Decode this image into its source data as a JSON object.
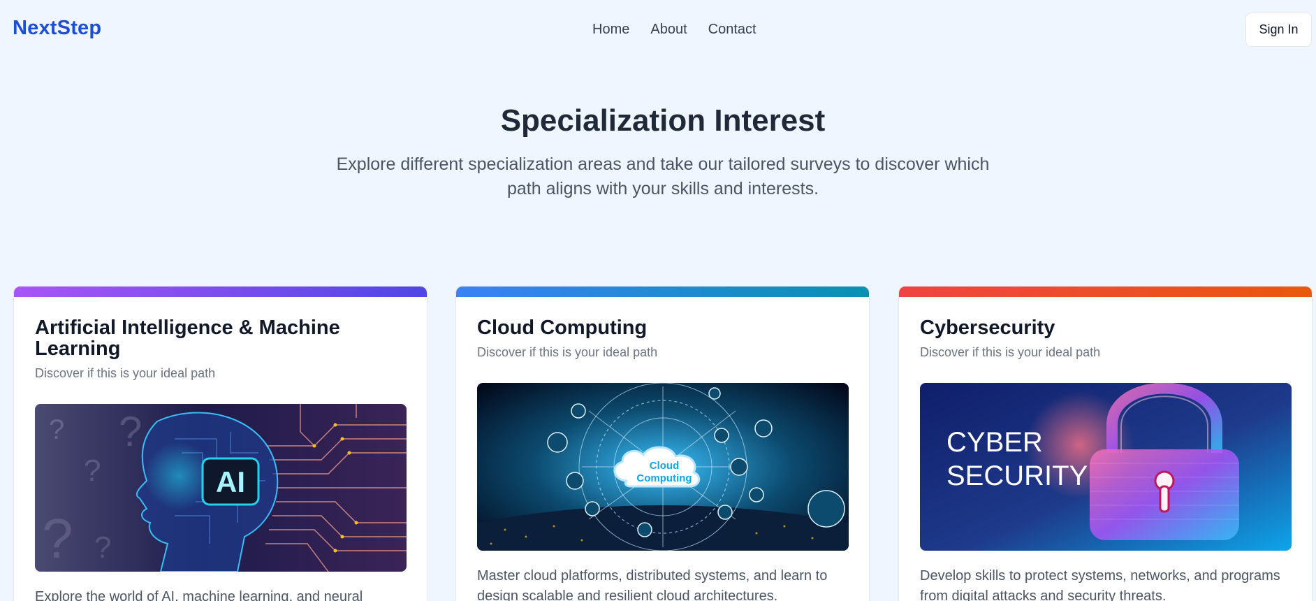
{
  "header": {
    "brand": "NextStep",
    "nav": [
      "Home",
      "About",
      "Contact"
    ],
    "sign_in": "Sign In"
  },
  "hero": {
    "title": "Specialization Interest",
    "subtitle": "Explore different specialization areas and take our tailored surveys to discover which path aligns with your skills and interests."
  },
  "cards": [
    {
      "title": "Artificial Intelligence & Machine Learning",
      "tagline": "Discover if this is your ideal path",
      "image_text": "AI",
      "description": "Explore the world of AI, machine learning, and neural",
      "accent_from": "#a855f7",
      "accent_to": "#4f46e5"
    },
    {
      "title": "Cloud Computing",
      "tagline": "Discover if this is your ideal path",
      "image_text_line1": "Cloud",
      "image_text_line2": "Computing",
      "description": "Master cloud platforms, distributed systems, and learn to design scalable and resilient cloud architectures.",
      "accent_from": "#3b82f6",
      "accent_to": "#0891b2"
    },
    {
      "title": "Cybersecurity",
      "tagline": "Discover if this is your ideal path",
      "image_text_line1": "CYBER",
      "image_text_line2": "SECURITY",
      "description": "Develop skills to protect systems, networks, and programs from digital attacks and security threats.",
      "accent_from": "#ef4444",
      "accent_to": "#ea580c"
    }
  ]
}
